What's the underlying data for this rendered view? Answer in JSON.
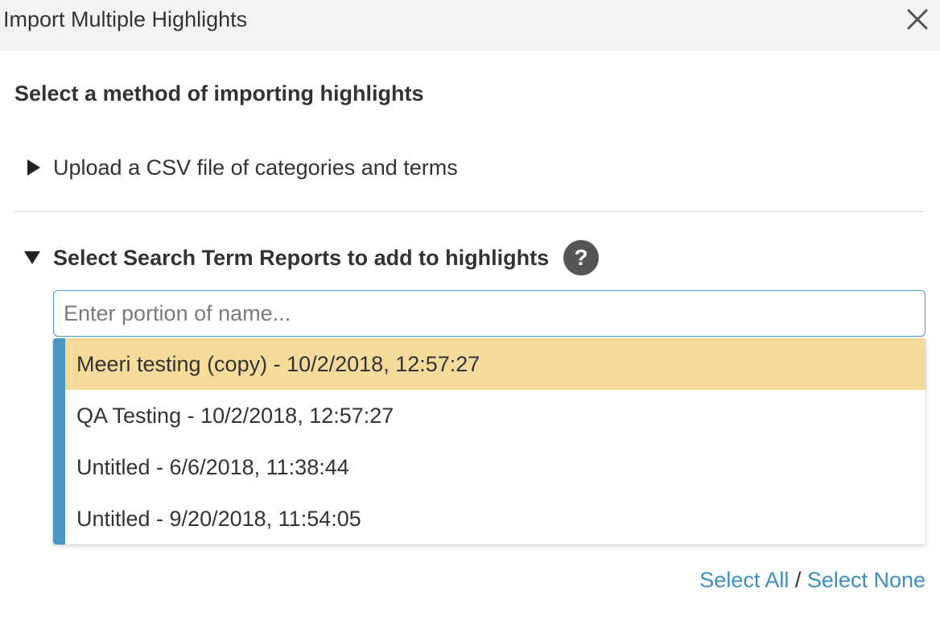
{
  "dialog": {
    "title": "Import Multiple Highlights",
    "close_icon": "close-icon"
  },
  "main": {
    "heading": "Select a method of importing highlights",
    "csv_section": {
      "label": "Upload a CSV file of categories and terms",
      "expanded": false,
      "caret_icon": "caret-right-icon"
    },
    "reports_section": {
      "label": "Select Search Term Reports to add to highlights",
      "expanded": true,
      "caret_icon": "caret-down-icon",
      "help_glyph": "?",
      "search": {
        "placeholder": "Enter portion of name...",
        "value": ""
      },
      "options": [
        {
          "label": "Meeri testing (copy) - 10/2/2018, 12:57:27",
          "highlighted": true
        },
        {
          "label": "QA Testing - 10/2/2018, 12:57:27",
          "highlighted": false
        },
        {
          "label": "Untitled - 6/6/2018, 11:38:44",
          "highlighted": false
        },
        {
          "label": "Untitled - 9/20/2018, 11:54:05",
          "highlighted": false
        }
      ],
      "select_all_label": "Select All",
      "separator": "/",
      "select_none_label": "Select None"
    }
  },
  "colors": {
    "header_bg": "#f3f3f3",
    "accent_blue": "#4a97c4",
    "link_blue": "#3d8fbf",
    "highlight": "#f5db9a",
    "help_icon_bg": "#555555"
  }
}
